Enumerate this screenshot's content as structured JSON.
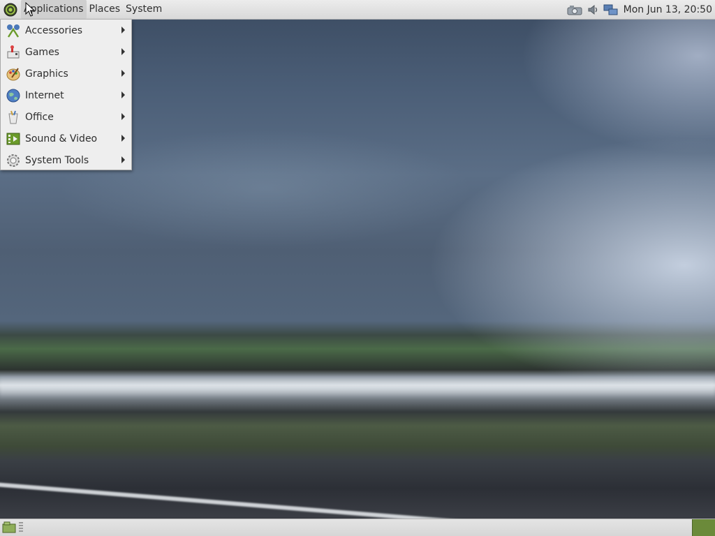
{
  "top_panel": {
    "menus": [
      "Applications",
      "Places",
      "System"
    ],
    "clock": "Mon Jun 13, 20:50",
    "tray_icons": [
      "camera-icon",
      "volume-icon",
      "network-icon"
    ]
  },
  "applications_menu": {
    "items": [
      {
        "label": "Accessories",
        "icon": "accessories-icon"
      },
      {
        "label": "Games",
        "icon": "games-icon"
      },
      {
        "label": "Graphics",
        "icon": "graphics-icon"
      },
      {
        "label": "Internet",
        "icon": "internet-icon"
      },
      {
        "label": "Office",
        "icon": "office-icon"
      },
      {
        "label": "Sound & Video",
        "icon": "sound-video-icon"
      },
      {
        "label": "System Tools",
        "icon": "system-tools-icon"
      }
    ]
  },
  "bottom_panel": {
    "icons": [
      "show-desktop-icon"
    ]
  },
  "colors": {
    "panel": "#e0e0e0",
    "menu_bg": "#eeeeee",
    "workspace": "#6b8a3a"
  }
}
